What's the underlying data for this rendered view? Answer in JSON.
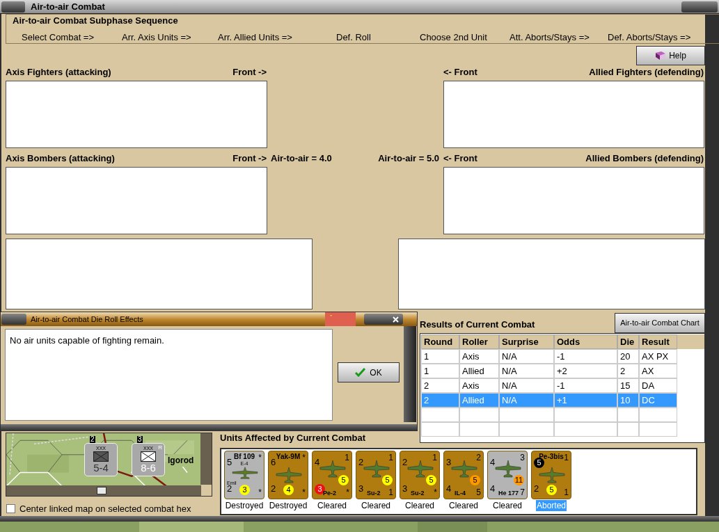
{
  "window": {
    "title": "Air-to-air Combat"
  },
  "sequence": {
    "title": "Air-to-air Combat Subphase Sequence",
    "steps": [
      "Select Combat =>",
      "Arr. Axis Units =>",
      "Arr. Allied Units =>",
      "Def. Roll",
      "Choose 2nd Unit",
      "Att. Aborts/Stays =>",
      "Def. Aborts/Stays =>"
    ]
  },
  "help_button": "Help",
  "fighters": {
    "axis_label": "Axis Fighters (attacking)",
    "axis_front": "Front ->",
    "allied_front": "<- Front",
    "allied_label": "Allied Fighters (defending)"
  },
  "bombers": {
    "axis_label": "Axis Bombers (attacking)",
    "axis_front": "Front ->",
    "axis_rating": "Air-to-air = 4.0",
    "allied_rating": "Air-to-air = 5.0",
    "allied_front": "<- Front",
    "allied_label": "Allied Bombers (defending)"
  },
  "dialog": {
    "title": "Air-to-air Combat Die Roll Effects",
    "message": "No air units capable of fighting remain.",
    "ok_button": "OK"
  },
  "results": {
    "title": "Results of Current Combat",
    "chart_button": "Air-to-air Combat Chart",
    "columns": [
      "Round",
      "Roller",
      "Surprise",
      "Odds",
      "Die",
      "Result"
    ],
    "rows": [
      {
        "cells": [
          "1",
          "Axis",
          "N/A",
          "-1",
          "20",
          "AX PX"
        ],
        "selected": false
      },
      {
        "cells": [
          "1",
          "Allied",
          "N/A",
          "+2",
          "2",
          "AX"
        ],
        "selected": false
      },
      {
        "cells": [
          "2",
          "Axis",
          "N/A",
          "-1",
          "15",
          "DA"
        ],
        "selected": false
      },
      {
        "cells": [
          "2",
          "Allied",
          "N/A",
          "+1",
          "10",
          "DC"
        ],
        "selected": true
      }
    ]
  },
  "map": {
    "counters": [
      {
        "echelon": "XXX",
        "strength": "5-4",
        "stack": "2"
      },
      {
        "echelon": "XXX",
        "corner": "R",
        "strength": "8-6",
        "stack": "3"
      }
    ],
    "place": "lgorod"
  },
  "center_checkbox": {
    "label": "Center linked map on selected combat hex",
    "checked": false
  },
  "units": {
    "title": "Units Affected by Current Combat",
    "items": [
      {
        "kind": "fighter",
        "color": "#b4b4b4",
        "name": "Bf 109",
        "sub": "E-4",
        "note": "Emil",
        "tl": {
          "text": "5"
        },
        "tr": "*",
        "bl": {
          "text": "2"
        },
        "br": "*",
        "circle": {
          "text": "3",
          "color": "#ffff00"
        },
        "status": "Destroyed",
        "selected": false
      },
      {
        "kind": "fighter",
        "color": "#b07c10",
        "name": "Yak-9M",
        "tl": {
          "text": "6"
        },
        "tr": "*",
        "bl": {
          "text": "2"
        },
        "br": "*",
        "circle": {
          "text": "4",
          "color": "#ffff00"
        },
        "status": "Destroyed",
        "selected": false
      },
      {
        "kind": "bomber",
        "color": "#b07c10",
        "name": "Pe-2",
        "tl": {
          "text": "4"
        },
        "tr": "1",
        "bl": {
          "text": "3",
          "color": "#ee1111"
        },
        "br": "*",
        "circle": {
          "text": "5",
          "color": "#ffff00"
        },
        "status": "Cleared",
        "selected": false
      },
      {
        "kind": "bomber",
        "color": "#b07c10",
        "name": "Su-2",
        "tl": {
          "text": "2"
        },
        "tr": "1",
        "bl": {
          "text": "3"
        },
        "br": "1",
        "circle": {
          "text": "5",
          "color": "#ffff00"
        },
        "status": "Cleared",
        "selected": false
      },
      {
        "kind": "bomber",
        "color": "#b07c10",
        "name": "Su-2",
        "tl": {
          "text": "2"
        },
        "tr": "1",
        "bl": {
          "text": "3"
        },
        "br": "*",
        "circle": {
          "text": "5",
          "color": "#ffff00"
        },
        "status": "Cleared",
        "selected": false
      },
      {
        "kind": "bomber",
        "color": "#b07c10",
        "name": "IL-4",
        "tl": {
          "text": "3"
        },
        "tr": "2",
        "bl": {
          "text": "4"
        },
        "br": "5",
        "circle": {
          "text": "5",
          "color": "#ff9900"
        },
        "status": "Cleared",
        "selected": false
      },
      {
        "kind": "bomber",
        "color": "#b4b4b4",
        "name": "He 177",
        "tl": {
          "text": "4"
        },
        "tr": "3",
        "bl": {
          "text": "4"
        },
        "br": "7",
        "circle": {
          "text": "11",
          "color": "#ff9900"
        },
        "status": "Cleared",
        "selected": false
      },
      {
        "kind": "fighter",
        "color": "#b07c10",
        "name": "Pe-3bis",
        "tl": {
          "text": "5",
          "color": "#000000"
        },
        "tr": "1",
        "bl": {
          "text": "2"
        },
        "br": "1",
        "circle": {
          "text": "5",
          "color": "#ffff00"
        },
        "status": "Aborted",
        "selected": true
      }
    ]
  }
}
